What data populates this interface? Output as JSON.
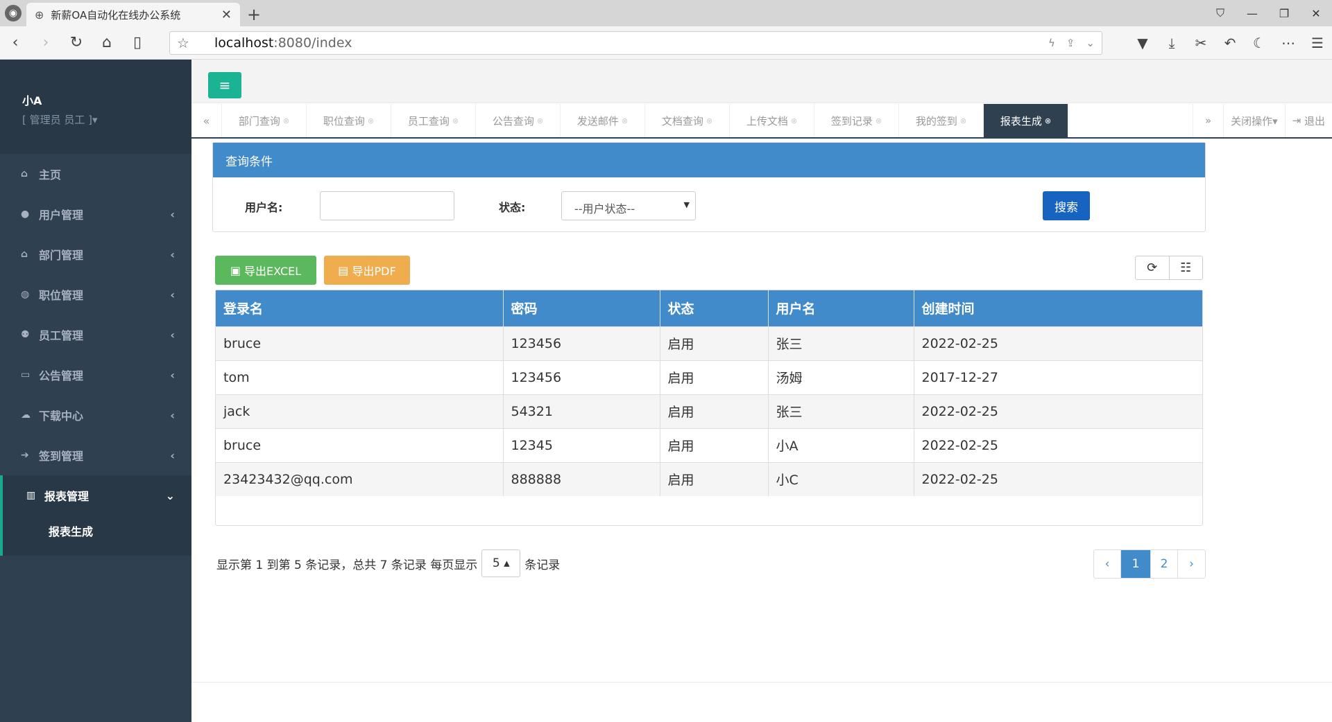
{
  "browser": {
    "tab_title": "新薪OA自动化在线办公系统",
    "url_host": "localhost",
    "url_rest": ":8080/index"
  },
  "profile": {
    "name": "小A",
    "role": "[ 管理员   员工 ]▾"
  },
  "sidebar": {
    "items": [
      {
        "label": "主页",
        "icon": "home-icon"
      },
      {
        "label": "用户管理",
        "icon": "user-icon"
      },
      {
        "label": "部门管理",
        "icon": "home-icon"
      },
      {
        "label": "职位管理",
        "icon": "rebel-icon"
      },
      {
        "label": "员工管理",
        "icon": "users-icon"
      },
      {
        "label": "公告管理",
        "icon": "desktop-icon"
      },
      {
        "label": "下载中心",
        "icon": "cloud-download-icon"
      },
      {
        "label": "签到管理",
        "icon": "sign-in-icon"
      },
      {
        "label": "报表管理",
        "icon": "bar-chart-icon"
      }
    ],
    "sub_item": "报表生成"
  },
  "tabs": [
    "部门查询",
    "职位查询",
    "员工查询",
    "公告查询",
    "发送邮件",
    "文档查询",
    "上传文档",
    "签到记录",
    "我的签到",
    "报表生成"
  ],
  "tab_actions": {
    "close_ops": "关闭操作▾",
    "logout": "退出"
  },
  "query": {
    "title": "查询条件",
    "username_label": "用户名:",
    "status_label": "状态:",
    "status_placeholder": "--用户状态--",
    "search_button": "搜索"
  },
  "export": {
    "excel": "导出EXCEL",
    "pdf": "导出PDF"
  },
  "table": {
    "headers": [
      "登录名",
      "密码",
      "状态",
      "用户名",
      "创建时间"
    ],
    "rows": [
      [
        "bruce",
        "123456",
        "启用",
        "张三",
        "2022-02-25"
      ],
      [
        "tom",
        "123456",
        "启用",
        "汤姆",
        "2017-12-27"
      ],
      [
        "jack",
        "54321",
        "启用",
        "张三",
        "2022-02-25"
      ],
      [
        "bruce",
        "12345",
        "启用",
        "小A",
        "2022-02-25"
      ],
      [
        "23423432@qq.com",
        "888888",
        "启用",
        "小C",
        "2022-02-25"
      ]
    ]
  },
  "pagination": {
    "info_prefix": "显示第 1 到第 5 条记录，总共 7 条记录 每页显示",
    "page_size": "5 ▴",
    "info_suffix": "条记录",
    "prev": "‹",
    "pages": [
      "1",
      "2"
    ],
    "next": "›"
  },
  "colors": {
    "sidebar": "#2f4050",
    "accent": "#1ab394",
    "primary": "#428bca",
    "search_btn": "#1764c0",
    "excel_btn": "#5cb85c",
    "pdf_btn": "#f0ad4e"
  }
}
